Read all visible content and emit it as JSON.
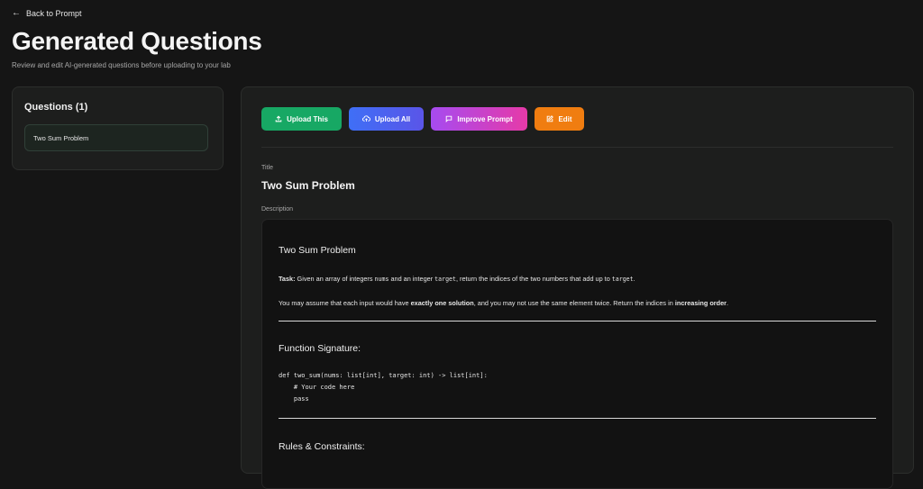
{
  "header": {
    "back_label": "Back to Prompt",
    "title": "Generated Questions",
    "subtitle": "Review and edit AI-generated questions before uploading to your lab"
  },
  "sidebar": {
    "heading": "Questions (1)",
    "items": [
      {
        "label": "Two Sum Problem"
      }
    ]
  },
  "toolbar": {
    "upload_this": "Upload This",
    "upload_all": "Upload All",
    "improve_prompt": "Improve Prompt",
    "edit": "Edit",
    "colors": {
      "upload_this": "#17a864",
      "upload_all": "#4a63f0",
      "improve_prompt": "#c444d4",
      "edit": "#f07d10"
    }
  },
  "detail": {
    "title_label": "Title",
    "title_value": "Two Sum Problem",
    "description_label": "Description",
    "description": {
      "heading": "Two Sum Problem",
      "task_label": "Task:",
      "task_text_1": " Given an array of integers ",
      "task_code_1": "nums",
      "task_text_2": " and an integer ",
      "task_code_2": "target",
      "task_text_3": ", return the indices of the two numbers that add up to ",
      "task_code_3": "target",
      "task_text_4": ".",
      "assume_text_1": "You may assume that each input would have ",
      "assume_bold_1": "exactly one solution",
      "assume_text_2": ", and you may not use the same element twice. Return the indices in ",
      "assume_bold_2": "increasing order",
      "assume_text_3": ".",
      "signature_heading": "Function Signature:",
      "code_line_1": "def two_sum(nums: list[int], target: int) -> list[int]:",
      "code_line_2": "    # Your code here",
      "code_line_3": "    pass",
      "rules_heading": "Rules & Constraints:"
    }
  },
  "icons": {
    "back": "arrow-left-icon",
    "upload_this": "upload-icon",
    "upload_all": "cloud-upload-icon",
    "improve_prompt": "message-square-icon",
    "edit": "edit-icon"
  }
}
